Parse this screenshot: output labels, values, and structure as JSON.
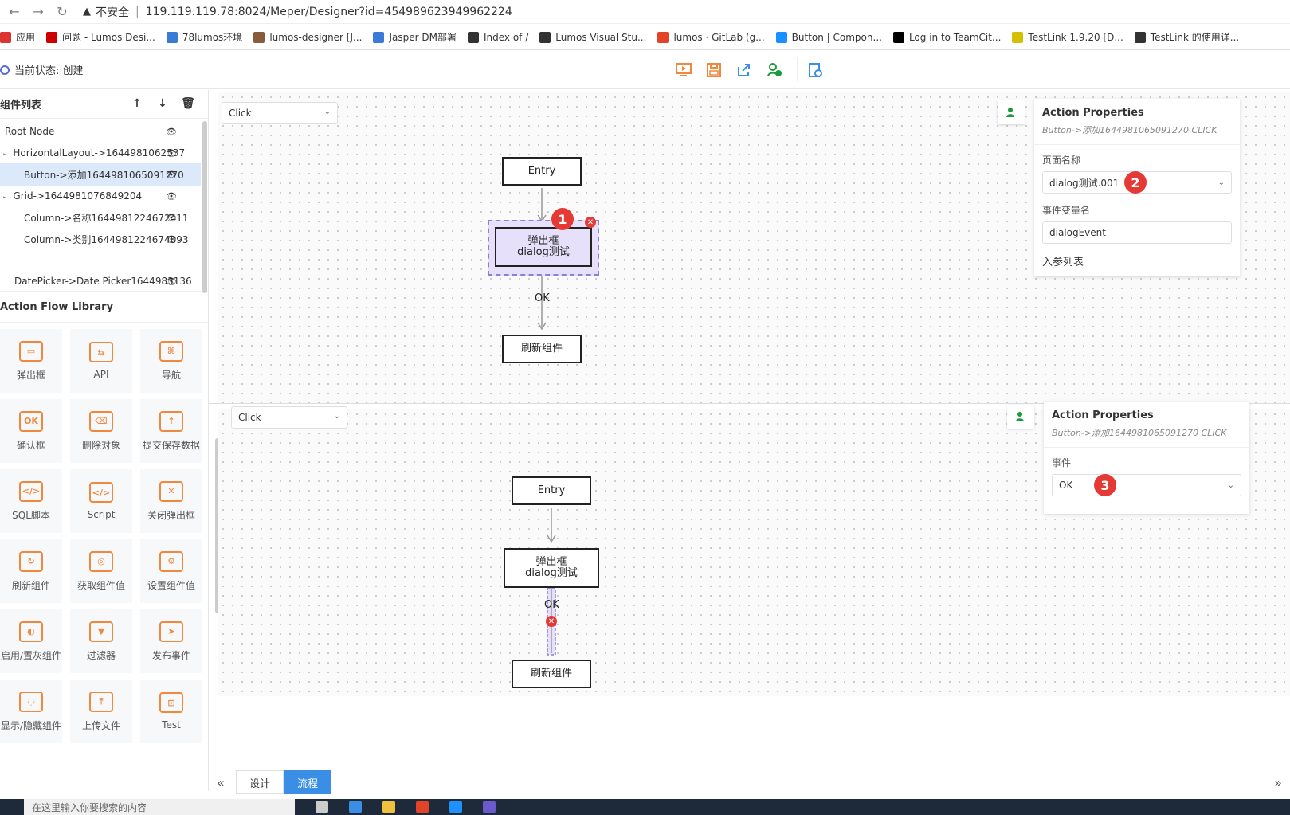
{
  "browser": {
    "security_label": "不安全",
    "url": "119.119.119.78:8024/Meper/Designer?id=454989623949962224",
    "bookmarks": [
      {
        "label": "应用",
        "color": "#d33"
      },
      {
        "label": "问题 - Lumos Desi...",
        "color": "#c00"
      },
      {
        "label": "78lumos环境",
        "color": "#3a7bd5"
      },
      {
        "label": "lumos-designer [J...",
        "color": "#8a5a3c"
      },
      {
        "label": "Jasper DM部署",
        "color": "#3a7bd5"
      },
      {
        "label": "Index of /",
        "color": "#333"
      },
      {
        "label": "Lumos Visual Stu...",
        "color": "#333"
      },
      {
        "label": "lumos · GitLab (g...",
        "color": "#e24329"
      },
      {
        "label": "Button | Compon...",
        "color": "#1890ff"
      },
      {
        "label": "Log in to TeamCit...",
        "color": "#000"
      },
      {
        "label": "TestLink 1.9.20 [D...",
        "color": "#d4c000"
      },
      {
        "label": "TestLink 的使用详...",
        "color": "#333"
      }
    ]
  },
  "header": {
    "status": "当前状态: 创建"
  },
  "left": {
    "component_list_title": "组件列表",
    "tree": [
      {
        "label": "Root Node",
        "indent": 0
      },
      {
        "label": "HorizontalLayout->1644981062537",
        "indent": 1,
        "arrow": "⌄"
      },
      {
        "label": "Button->添加1644981065091270",
        "indent": 2,
        "selected": true
      },
      {
        "label": "Grid->1644981076849204",
        "indent": 1,
        "arrow": "⌄"
      },
      {
        "label": "Column->名称1644981224672411",
        "indent": 2
      },
      {
        "label": "Column->类别1644981224674893",
        "indent": 2
      },
      {
        "label": "DatePicker->Date Picker1644983136",
        "indent": 1
      }
    ],
    "library_title": "Action Flow Library",
    "library": [
      {
        "label": "弹出框",
        "glyph": "▭"
      },
      {
        "label": "API",
        "glyph": "⇆"
      },
      {
        "label": "导航",
        "glyph": "⌘"
      },
      {
        "label": "确认框",
        "glyph": "OK"
      },
      {
        "label": "删除对象",
        "glyph": "⌫"
      },
      {
        "label": "提交保存数据",
        "glyph": "↑"
      },
      {
        "label": "SQL脚本",
        "glyph": "</>"
      },
      {
        "label": "Script",
        "glyph": "</>"
      },
      {
        "label": "关闭弹出框",
        "glyph": "✕"
      },
      {
        "label": "刷新组件",
        "glyph": "↻"
      },
      {
        "label": "获取组件值",
        "glyph": "◎"
      },
      {
        "label": "设置组件值",
        "glyph": "⚙"
      },
      {
        "label": "启用/置灰组件",
        "glyph": "◐"
      },
      {
        "label": "过滤器",
        "glyph": "▼"
      },
      {
        "label": "发布事件",
        "glyph": "➤"
      },
      {
        "label": "显示/隐藏组件",
        "glyph": "◌"
      },
      {
        "label": "上传文件",
        "glyph": "⤒"
      },
      {
        "label": "Test",
        "glyph": "⊡"
      }
    ]
  },
  "flow1": {
    "event_select": "Click",
    "entry": "Entry",
    "dialog_line1": "弹出框",
    "dialog_line2": "dialog测试",
    "edge_label": "OK",
    "refresh": "刷新组件",
    "marker": "1",
    "props": {
      "title": "Action Properties",
      "subtitle": "Button->添加1644981065091270 CLICK",
      "page_name_label": "页面名称",
      "page_name_value": "dialog测试.001",
      "page_marker": "2",
      "event_var_label": "事件变量名",
      "event_var_value": "dialogEvent",
      "params_label": "入参列表"
    }
  },
  "flow2": {
    "event_select": "Click",
    "entry": "Entry",
    "dialog_line1": "弹出框",
    "dialog_line2": "dialog测试",
    "edge_label": "OK",
    "refresh": "刷新组件",
    "props": {
      "title": "Action Properties",
      "subtitle": "Button->添加1644981065091270 CLICK",
      "event_label": "事件",
      "event_value": "OK",
      "event_marker": "3"
    }
  },
  "tabs": {
    "design": "设计",
    "flow": "流程"
  },
  "taskbar": {
    "search_placeholder": "在这里输入你要搜索的内容"
  },
  "colors": {
    "accent": "#3a8ee6",
    "marker": "#e53935",
    "selected_node": "#e6e0fb",
    "toolbar_orange": "#f0883e"
  }
}
